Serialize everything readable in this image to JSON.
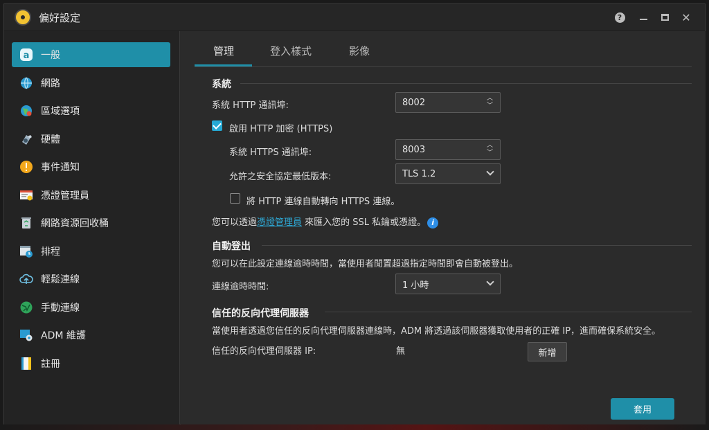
{
  "window": {
    "title": "偏好設定"
  },
  "sidebar": {
    "items": [
      {
        "label": "一般"
      },
      {
        "label": "網路"
      },
      {
        "label": "區域選項"
      },
      {
        "label": "硬體"
      },
      {
        "label": "事件通知"
      },
      {
        "label": "憑證管理員"
      },
      {
        "label": "網路資源回收桶"
      },
      {
        "label": "排程"
      },
      {
        "label": "輕鬆連線"
      },
      {
        "label": "手動連線"
      },
      {
        "label": "ADM 維護"
      },
      {
        "label": "註冊"
      }
    ]
  },
  "tabs": [
    {
      "label": "管理"
    },
    {
      "label": "登入樣式"
    },
    {
      "label": "影像"
    }
  ],
  "system": {
    "title": "系統",
    "http_port_label": "系統 HTTP 通訊埠:",
    "http_port_value": "8002",
    "https_enable_label": "啟用 HTTP 加密 (HTTPS)",
    "https_port_label": "系統 HTTPS 通訊埠:",
    "https_port_value": "8003",
    "tls_label": "允許之安全協定最低版本:",
    "tls_value": "TLS 1.2",
    "redirect_label": "將 HTTP 連線自動轉向 HTTPS 連線。",
    "ssl_note_pre": "您可以透過",
    "ssl_note_link": "憑證管理員",
    "ssl_note_post": "來匯入您的 SSL 私鑰或憑證。"
  },
  "auto_logout": {
    "title": "自動登出",
    "desc": "您可以在此設定連線逾時時間，當使用者閒置超過指定時間即會自動被登出。",
    "timeout_label": "連線逾時時間:",
    "timeout_value": "1 小時"
  },
  "proxy": {
    "title": "信任的反向代理伺服器",
    "desc": "當使用者透過您信任的反向代理伺服器連線時，ADM 將透過該伺服器獲取使用者的正確 IP，進而確保系統安全。",
    "ip_label": "信任的反向代理伺服器 IP:",
    "ip_value": "無",
    "add_label": "新增"
  },
  "footer": {
    "apply_label": "套用"
  },
  "colors": {
    "accent": "#1f8fa8",
    "link": "#2ea9d6",
    "checkbox": "#25a9d4"
  }
}
